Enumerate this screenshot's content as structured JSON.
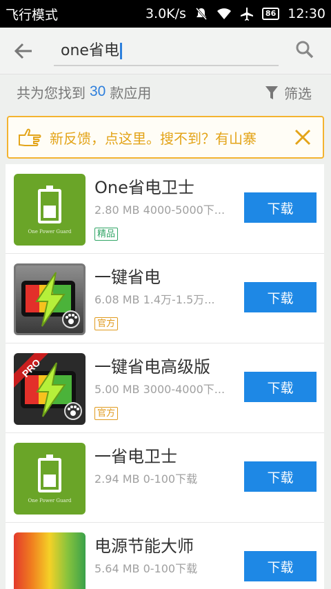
{
  "status_bar": {
    "left_text": "飞行模式",
    "speed": "3.0K/s",
    "battery": "86",
    "time": "12:30"
  },
  "search": {
    "query": "one省电",
    "back_icon": "arrow-left-icon",
    "search_icon": "search-icon"
  },
  "results": {
    "prefix": "共为您找到",
    "count": "30",
    "suffix": "款应用",
    "filter_label": "筛选"
  },
  "notice": {
    "text": "新反馈，点这里。搜不到？有山寨"
  },
  "apps": [
    {
      "name": "One省电卫士",
      "size": "2.80 MB",
      "downloads": "4000-5000下...",
      "badge": "精品",
      "button": "下载",
      "icon_caption": "One Power Guard"
    },
    {
      "name": "一键省电",
      "size": "6.08 MB",
      "downloads": "1.4万-1.5万...",
      "badge": "官方",
      "button": "下载"
    },
    {
      "name": "一键省电高级版",
      "size": "5.00 MB",
      "downloads": "3000-4000下...",
      "badge": "官方",
      "button": "下载",
      "icon_ribbon": "PRO"
    },
    {
      "name": "一省电卫士",
      "size": "2.94 MB",
      "downloads": "0-100下载",
      "button": "下载",
      "icon_caption": "One Power Guard"
    },
    {
      "name": "电源节能大师",
      "size": "5.64 MB",
      "downloads": "0-100下载",
      "button": "下载"
    }
  ],
  "colors": {
    "accent_blue": "#1e88e5",
    "notice_orange": "#f3b32f",
    "badge_green": "#31a566",
    "badge_orange": "#e09a1c"
  }
}
